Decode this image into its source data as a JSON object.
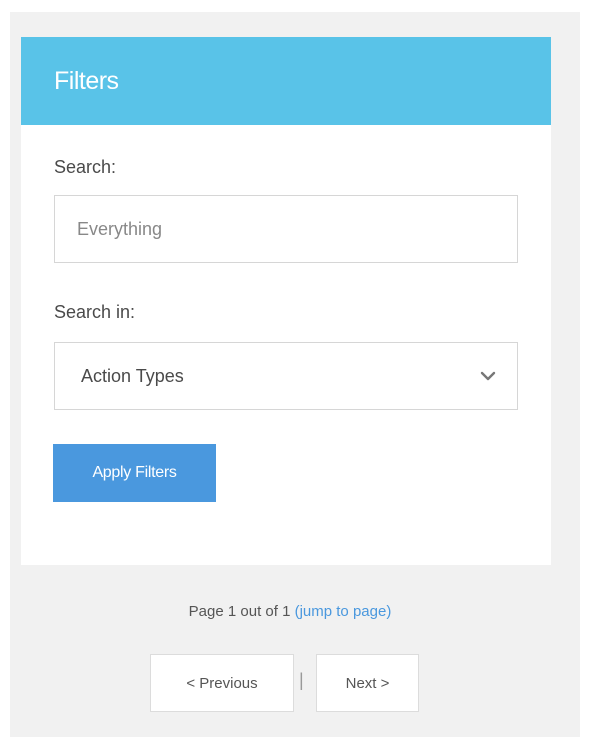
{
  "filters": {
    "title": "Filters",
    "search_label": "Search:",
    "search_placeholder": "Everything",
    "search_value": "",
    "search_in_label": "Search in:",
    "search_in_selected": "Action Types",
    "apply_button_label": "Apply Filters",
    "header_color": "#59c3e8",
    "button_color": "#4a98de"
  },
  "pagination": {
    "info_text": "Page 1 out of 1 ",
    "jump_link_text": "(jump to page)",
    "previous_label": "< Previous",
    "separator": "|",
    "next_label": "Next >",
    "current_page": 1,
    "total_pages": 1
  },
  "icons": {
    "select_chevron": "chevron-down-icon"
  }
}
